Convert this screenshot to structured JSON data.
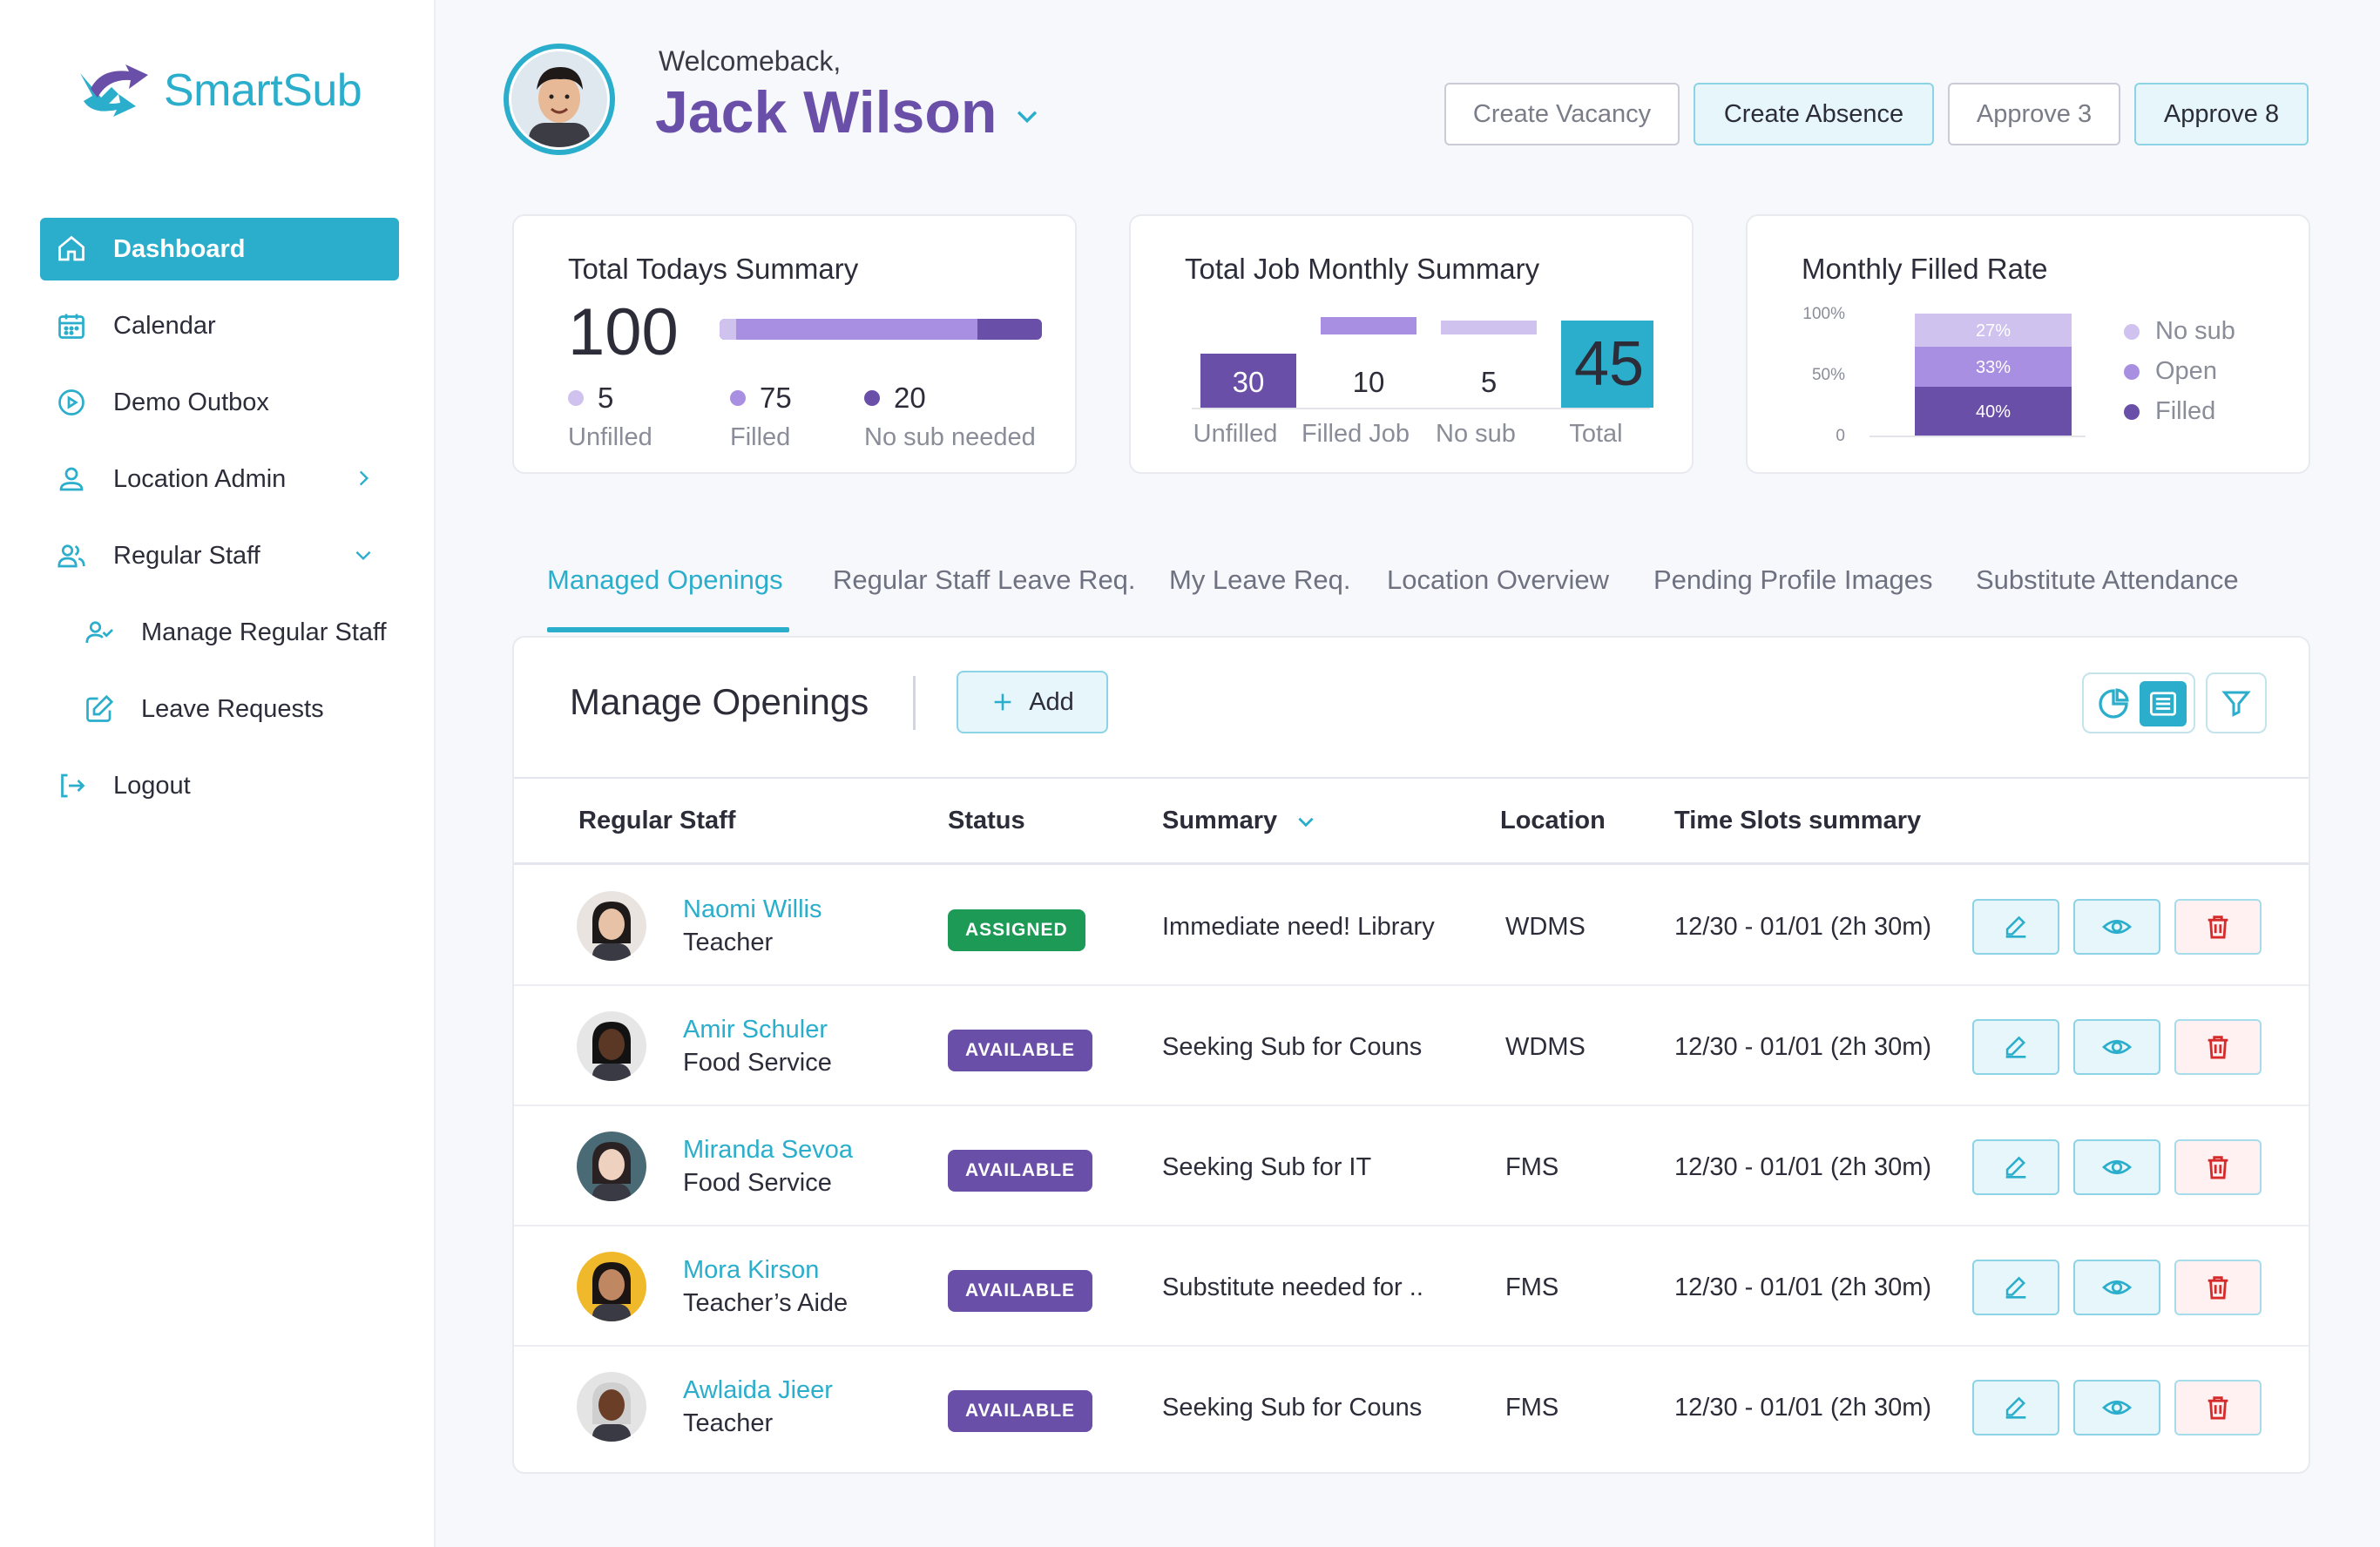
{
  "brand": {
    "name": "SmartSub",
    "accent": "#2aaecb",
    "purple": "#6a4fa9"
  },
  "sidebar": {
    "items": [
      {
        "label": "Dashboard",
        "icon": "home-icon",
        "active": true
      },
      {
        "label": "Calendar",
        "icon": "calendar-icon"
      },
      {
        "label": "Demo Outbox",
        "icon": "play-circle-icon"
      },
      {
        "label": "Location Admin",
        "icon": "location-user-icon",
        "trailing": "chevron-right-icon"
      },
      {
        "label": "Regular Staff",
        "icon": "users-icon",
        "trailing": "chevron-down-icon"
      },
      {
        "label": "Manage Regular Staff",
        "icon": "user-check-icon",
        "sub": true
      },
      {
        "label": "Leave Requests",
        "icon": "edit-square-icon",
        "sub": true
      },
      {
        "label": "Logout",
        "icon": "logout-icon"
      }
    ]
  },
  "header": {
    "welcome": "Welcomeback,",
    "user_name": "Jack Wilson",
    "buttons": {
      "create_vacancy": "Create Vacancy",
      "create_absence": "Create Absence",
      "approve_3": "Approve 3",
      "approve_8": "Approve 8"
    }
  },
  "today_summary": {
    "title": "Total Todays Summary",
    "total": "100",
    "items": [
      {
        "value": "5",
        "label": "Unfilled",
        "color": "#cfc2ee"
      },
      {
        "value": "75",
        "label": "Filled",
        "color": "#a98fe1"
      },
      {
        "value": "20",
        "label": "No sub needed",
        "color": "#6a4fa9"
      }
    ],
    "bar_fractions": {
      "unfilled": 0.05,
      "filled": 0.75,
      "no_sub_needed": 0.2
    }
  },
  "chart_data": [
    {
      "type": "bar",
      "title": "Total Job Monthly Summary",
      "categories": [
        "Unfilled",
        "Filled Job",
        "No sub",
        "Total"
      ],
      "values": [
        30,
        10,
        5,
        45
      ],
      "value_labels": [
        "30",
        "10",
        "5",
        "45"
      ],
      "colors": [
        "#6a4fa9",
        "#a98fe1",
        "#cfc2ee",
        "#2aaecb"
      ]
    },
    {
      "type": "bar",
      "stacked": true,
      "title": "Monthly Filled Rate",
      "yticks": [
        "100%",
        "50%",
        "0"
      ],
      "ylim": [
        0,
        100
      ],
      "series": [
        {
          "name": "Filled",
          "values": [
            40
          ],
          "label": "40%",
          "color": "#6a4fa9"
        },
        {
          "name": "Open",
          "values": [
            33
          ],
          "label": "33%",
          "color": "#a98fe1"
        },
        {
          "name": "No sub",
          "values": [
            27
          ],
          "label": "27%",
          "color": "#cfc2ee"
        }
      ],
      "legend": [
        "No sub",
        "Open",
        "Filled"
      ],
      "legend_placement": "right"
    }
  ],
  "tabs": [
    {
      "label": "Managed Openings",
      "active": true
    },
    {
      "label": "Regular Staff Leave Req."
    },
    {
      "label": "My Leave Req."
    },
    {
      "label": "Location Overview"
    },
    {
      "label": "Pending Profile Images"
    },
    {
      "label": "Substitute Attendance"
    }
  ],
  "openings": {
    "title": "Manage Openings",
    "add_label": "Add",
    "columns": [
      "Regular Staff",
      "Status",
      "Summary",
      "Location",
      "Time Slots summary"
    ],
    "rows": [
      {
        "name": "Naomi Willis",
        "role": "Teacher",
        "status": "ASSIGNED",
        "status_color": "#1e9a57",
        "summary": "Immediate need! Library",
        "location": "WDMS",
        "slot": "12/30 - 01/01 (2h 30m)",
        "avatar_bg": "#e9e4df",
        "skin": "#e8c2a6",
        "hair": "#1e1a1a"
      },
      {
        "name": "Amir Schuler",
        "role": "Food Service",
        "status": "AVAILABLE",
        "status_color": "#6a4fa9",
        "summary": "Seeking Sub for Couns",
        "location": "WDMS",
        "slot": "12/30 - 01/01 (2h 30m)",
        "avatar_bg": "#e6e6e6",
        "skin": "#5a3825",
        "hair": "#121212"
      },
      {
        "name": "Miranda Sevoa",
        "role": "Food Service",
        "status": "AVAILABLE",
        "status_color": "#6a4fa9",
        "summary": "Seeking Sub for IT",
        "location": "FMS",
        "slot": "12/30 - 01/01 (2h 30m)",
        "avatar_bg": "#4a6a76",
        "skin": "#eed1bf",
        "hair": "#2a2222"
      },
      {
        "name": "Mora Kirson",
        "role": "Teacher’s Aide",
        "status": "AVAILABLE",
        "status_color": "#6a4fa9",
        "summary": "Substitute  needed for ..",
        "location": "FMS",
        "slot": "12/30 - 01/01 (2h 30m)",
        "avatar_bg": "#f0b92c",
        "skin": "#c08763",
        "hair": "#1a1412"
      },
      {
        "name": "Awlaida Jieer",
        "role": "Teacher",
        "status": "AVAILABLE",
        "status_color": "#6a4fa9",
        "summary": "Seeking Sub for Couns",
        "location": "FMS",
        "slot": "12/30 - 01/01 (2h 30m)",
        "avatar_bg": "#e4e4e4",
        "skin": "#6b3e27",
        "hair": "#cfcfcf"
      }
    ]
  }
}
